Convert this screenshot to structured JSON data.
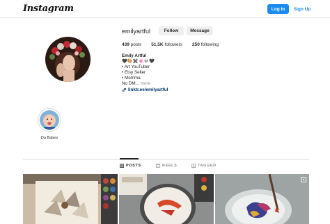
{
  "header": {
    "logo_text": "Instagram",
    "login_label": "Log In",
    "signup_label": "Sign Up"
  },
  "profile": {
    "username": "emilyartful",
    "follow_label": "Follow",
    "message_label": "Message",
    "stats": {
      "posts_count": "439",
      "posts_label": "posts",
      "followers_count": "51.5K",
      "followers_label": "followers",
      "following_count": "250",
      "following_label": "following"
    },
    "bio": {
      "name": "Emily Artful",
      "emoji_line": "🖤🎨✖️🌸💀🖤",
      "lines": [
        "• Art YouTuber",
        "• Etsy Seller",
        "• Momma"
      ],
      "truncated_text": "No DM...",
      "more_label": "more",
      "link": "linktr.ee/emilyartful"
    }
  },
  "highlights": [
    {
      "label": "Da Babes"
    }
  ],
  "tabs": [
    {
      "label": "POSTS",
      "active": true
    },
    {
      "label": "REELS",
      "active": false
    },
    {
      "label": "TAGGED",
      "active": false
    }
  ],
  "colors": {
    "accent": "#1a8cf0",
    "link": "#00376b",
    "muted": "#8e8e8e",
    "button_bg": "#efefef"
  }
}
